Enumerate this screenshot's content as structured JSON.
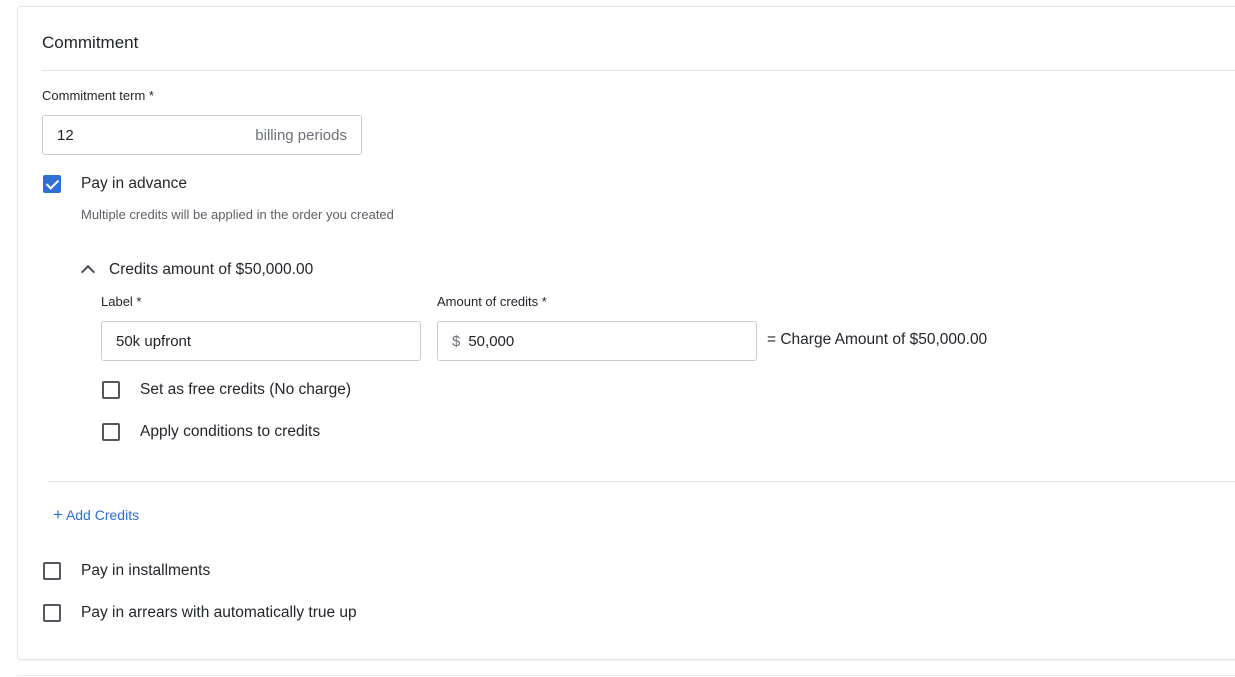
{
  "section": {
    "title": "Commitment"
  },
  "commitment_term": {
    "label": "Commitment term *",
    "value": "12",
    "suffix": "billing periods"
  },
  "pay_in_advance": {
    "label": "Pay in advance",
    "checked": true,
    "help": "Multiple credits will be applied in the order you created"
  },
  "credits_block": {
    "heading": "Credits amount of $50,000.00",
    "label_field": {
      "label": "Label *",
      "value": "50k upfront"
    },
    "amount_field": {
      "label": "Amount of credits *",
      "prefix": "$",
      "value": "50,000"
    },
    "charge_text": "= Charge Amount of $50,000.00",
    "free_credits": {
      "label": "Set as free credits (No charge)",
      "checked": false
    },
    "apply_conditions": {
      "label": "Apply conditions to credits",
      "checked": false
    }
  },
  "add_credits": {
    "icon": "plus-icon",
    "label": "Add Credits"
  },
  "pay_in_installments": {
    "label": "Pay in installments",
    "checked": false
  },
  "pay_in_arrears": {
    "label": "Pay in arrears with automatically true up",
    "checked": false
  },
  "colors": {
    "accent": "#2f6fd6",
    "border": "#c8ccd1",
    "text": "#22262b"
  }
}
